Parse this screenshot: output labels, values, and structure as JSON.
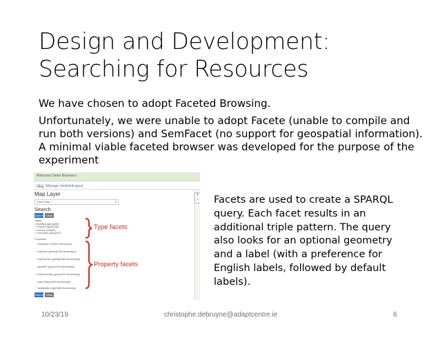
{
  "slide": {
    "title_line1": "Design and Development:",
    "title_line2": "Searching for Resources",
    "para1": "We have chosen to adopt Faceted Browsing.",
    "para2": "Unfortunately, we were unable to adopt Facete (unable to compile and run both versions) and SemFacet (no support for geospatial information). A minimal viable faceted browser was developed for the purpose of the experiment",
    "side_text": "Facets are used to create a SPARQL query. Each facet results in an additional triple pattern. The query also looks for an optional geometry and a label (with a preference for English labels, followed by default labels)."
  },
  "footer": {
    "date": "10/23/19",
    "email": "christophe.debruyne@adaptcentre.ie",
    "page": "6"
  },
  "screenshot": {
    "app_title": "Welcome Dieter Bosmans",
    "tabs": [
      "Map",
      "Manage interlinks",
      "Logout"
    ],
    "map_layer_label": "Map Layer",
    "layer_select_value": "Street Map",
    "search_label": "Search",
    "submit_label": "Submit",
    "clear_label": "Clear",
    "types_header": "Types",
    "type_items": [
      "Building (geo)(489)",
      "Feature (geo)(332)",
      "County (osi)(26)",
      "Geometry (geo)(322)"
    ],
    "properties_header": "Properties",
    "property_items": [
      "inDataset (1043)/1 elements(s)",
      "hasForm (geoff)(1048 elements(s))",
      "hasFunction (geoff)(1485 elements(s))",
      "geoWKT (geo)(1519 elements(s))",
      "hasGeometry (geo)(1519 elements(s))",
      "label (rdfs)(2053 elements(s))",
      "lastUpdate (osi)(1468 elements(s))"
    ],
    "zoom_in": "+",
    "zoom_out": "−",
    "annotation_types": "Type facets",
    "annotation_properties": "Property facets"
  },
  "colors": {
    "annotation": "#d12a20",
    "button_primary": "#2d74c4",
    "header_bar": "#e1ecd6"
  }
}
